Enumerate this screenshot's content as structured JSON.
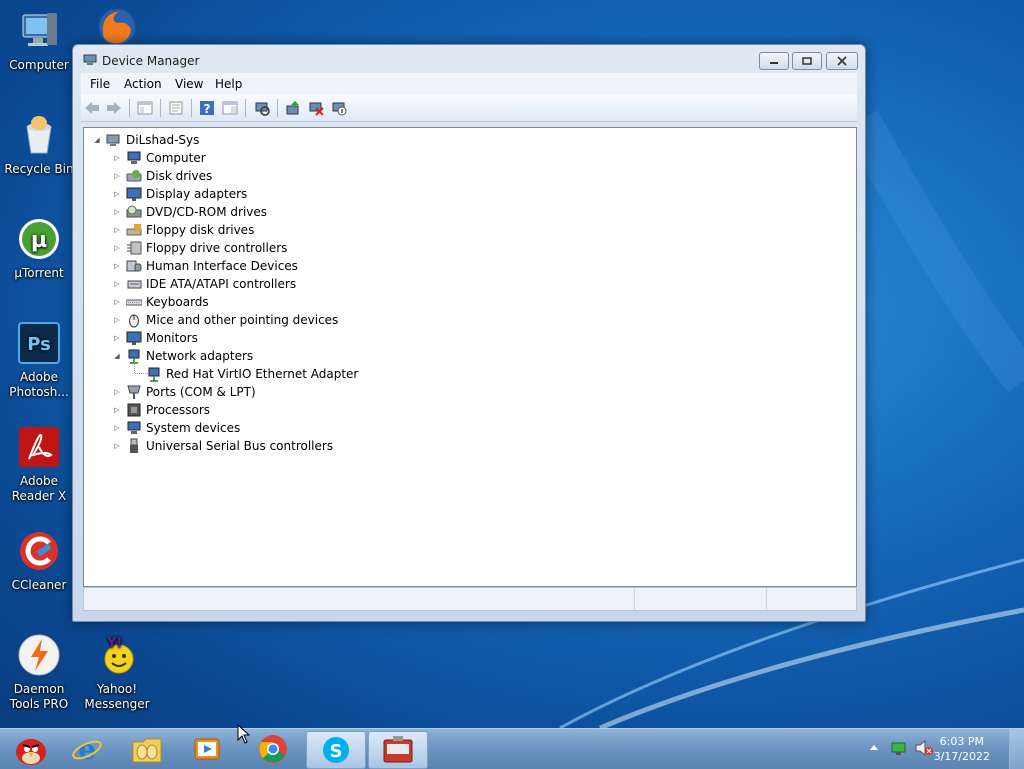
{
  "desktop": {
    "icons": [
      {
        "label": "Computer",
        "icon": "computer-icon"
      },
      {
        "label": "Recycle Bin",
        "icon": "recycle-bin-icon"
      },
      {
        "label": "µTorrent",
        "icon": "utorrent-icon"
      },
      {
        "label": "Adobe Photosh...",
        "icon": "photoshop-icon"
      },
      {
        "label": "Adobe Reader X",
        "icon": "adobe-reader-icon"
      },
      {
        "label": "CCleaner",
        "icon": "ccleaner-icon"
      },
      {
        "label": "Daemon Tools PRO",
        "icon": "daemon-tools-icon"
      },
      {
        "label": "Yahoo! Messenger",
        "icon": "yahoo-messenger-icon"
      },
      {
        "label": "",
        "icon": "firefox-icon"
      }
    ]
  },
  "window": {
    "title": "Device Manager",
    "menu": [
      "File",
      "Action",
      "View",
      "Help"
    ],
    "toolbar_icons": [
      "back-arrow-icon",
      "forward-arrow-icon",
      "console-tree-icon",
      "properties-icon",
      "help-icon",
      "action-pane-icon",
      "scan-hardware-icon",
      "update-driver-icon",
      "uninstall-icon",
      "disable-device-icon"
    ],
    "tree": {
      "root": "DiLshad-Sys",
      "items": [
        {
          "label": "Computer",
          "icon": "computer-icon"
        },
        {
          "label": "Disk drives",
          "icon": "disk-drive-icon"
        },
        {
          "label": "Display adapters",
          "icon": "display-adapter-icon"
        },
        {
          "label": "DVD/CD-ROM drives",
          "icon": "dvd-drive-icon"
        },
        {
          "label": "Floppy disk drives",
          "icon": "floppy-disk-icon"
        },
        {
          "label": "Floppy drive controllers",
          "icon": "floppy-controller-icon"
        },
        {
          "label": "Human Interface Devices",
          "icon": "hid-icon"
        },
        {
          "label": "IDE ATA/ATAPI controllers",
          "icon": "ide-controller-icon"
        },
        {
          "label": "Keyboards",
          "icon": "keyboard-icon"
        },
        {
          "label": "Mice and other pointing devices",
          "icon": "mouse-icon"
        },
        {
          "label": "Monitors",
          "icon": "monitor-icon"
        },
        {
          "label": "Network adapters",
          "icon": "network-adapter-icon",
          "expanded": true,
          "children": [
            {
              "label": "Red Hat VirtIO Ethernet Adapter",
              "icon": "network-adapter-icon"
            }
          ]
        },
        {
          "label": "Ports (COM & LPT)",
          "icon": "port-icon"
        },
        {
          "label": "Processors",
          "icon": "processor-icon"
        },
        {
          "label": "System devices",
          "icon": "system-device-icon"
        },
        {
          "label": "Universal Serial Bus controllers",
          "icon": "usb-icon"
        }
      ]
    }
  },
  "taskbar": {
    "apps": [
      "angry-birds-icon",
      "internet-explorer-icon",
      "windows-explorer-icon",
      "media-player-icon",
      "chrome-icon",
      "skype-icon",
      "device-manager-taskbar-icon"
    ],
    "clock": {
      "time": "6:03 PM",
      "date": "3/17/2022"
    }
  },
  "colors": {
    "accent": "#1466b8",
    "taskbar": "#6e96c2"
  }
}
